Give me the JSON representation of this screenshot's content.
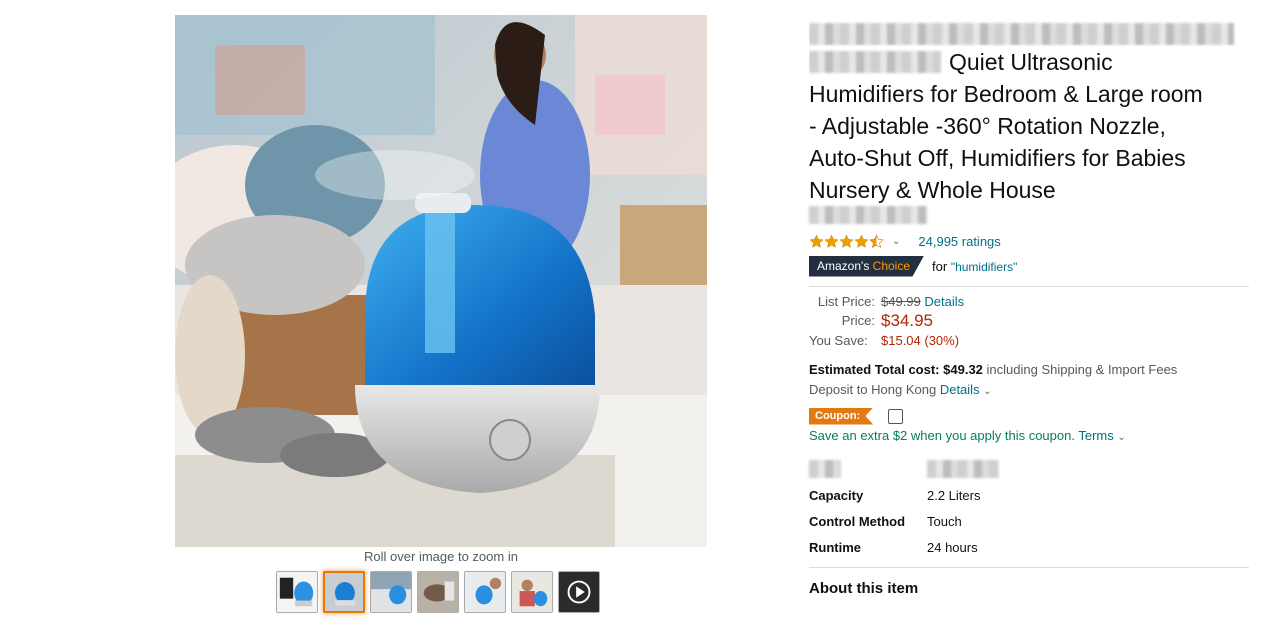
{
  "gallery": {
    "zoom_hint": "Roll over image to zoom in",
    "thumbnails": [
      {
        "name": "thumb-1",
        "selected": false
      },
      {
        "name": "thumb-2",
        "selected": true
      },
      {
        "name": "thumb-3",
        "selected": false
      },
      {
        "name": "thumb-4",
        "selected": false
      },
      {
        "name": "thumb-5",
        "selected": false
      },
      {
        "name": "thumb-6",
        "selected": false
      },
      {
        "name": "thumb-video",
        "selected": false
      }
    ]
  },
  "product": {
    "title_line2": "Quiet Ultrasonic",
    "title_line3": "Humidifiers for Bedroom & Large room",
    "title_line4": "- Adjustable -360° Rotation Nozzle,",
    "title_line5": "Auto-Shut Off, Humidifiers for Babies",
    "title_line6": "Nursery & Whole House",
    "rating_stars": 4.5,
    "ratings_count": "24,995 ratings",
    "choice_prefix": "Amazon's",
    "choice_accent": "Choice",
    "choice_for": "for",
    "choice_keyword": "\"humidifiers\""
  },
  "pricing": {
    "list_label": "List Price:",
    "list_price": "$49.99",
    "list_details": "Details",
    "price_label": "Price:",
    "price": "$34.95",
    "save_label": "You Save:",
    "save_value": "$15.04 (30%)",
    "est_label": "Estimated Total cost:",
    "est_value": "$49.32",
    "est_suffix": "including Shipping & Import Fees",
    "deposit_text": "Deposit to Hong Kong",
    "deposit_details": "Details"
  },
  "coupon": {
    "badge": "Coupon:",
    "text": "Save an extra $2 when you apply this coupon.",
    "terms": "Terms"
  },
  "specs": [
    {
      "key": "Capacity",
      "value": "2.2 Liters"
    },
    {
      "key": "Control Method",
      "value": "Touch"
    },
    {
      "key": "Runtime",
      "value": "24 hours"
    }
  ],
  "about_heading": "About this item",
  "colors": {
    "price": "#B12704",
    "link": "#007185",
    "coupon": "#e47911",
    "choice_bg": "#232f3e"
  }
}
